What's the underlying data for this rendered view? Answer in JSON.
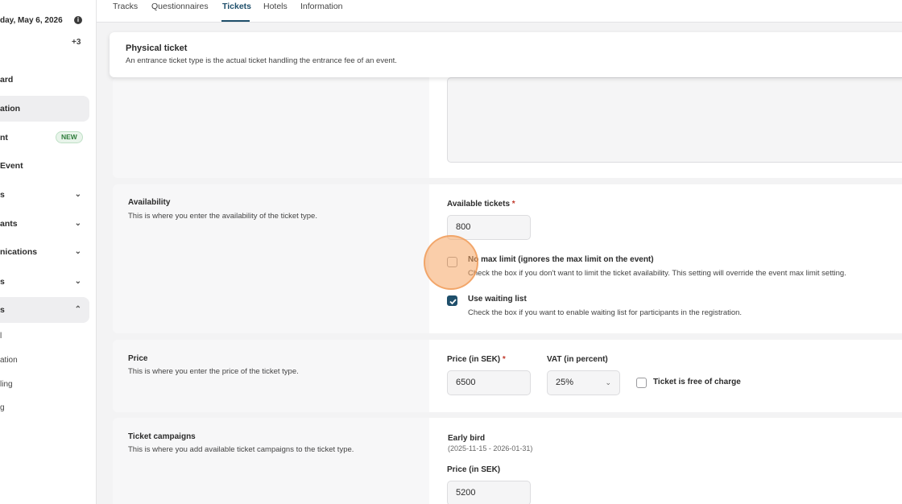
{
  "sidebar": {
    "date": "day, May 6, 2026",
    "more_count": "+3",
    "items": [
      {
        "label": "ard"
      },
      {
        "label": "ation"
      },
      {
        "label": "nt",
        "badge": "NEW"
      },
      {
        "label": "Event"
      },
      {
        "label": "s"
      },
      {
        "label": "ants"
      },
      {
        "label": "nications"
      },
      {
        "label": "s"
      },
      {
        "label": "s"
      }
    ],
    "sub_items": [
      "l",
      "ation",
      "ling",
      "g"
    ]
  },
  "tabs": [
    {
      "label": "Tracks"
    },
    {
      "label": "Questionnaires"
    },
    {
      "label": "Tickets",
      "active": true
    },
    {
      "label": "Hotels"
    },
    {
      "label": "Information"
    }
  ],
  "header": {
    "title": "Physical ticket",
    "description": "An entrance ticket type is the actual ticket handling the entrance fee of an event."
  },
  "availability": {
    "title": "Availability",
    "description": "This is where you enter the availability of the ticket type.",
    "tickets_label": "Available tickets",
    "tickets_value": "800",
    "no_max": {
      "title": "No max limit (ignores the max limit on the event)",
      "description": "Check the box if you don't want to limit the ticket availability. This setting will override the event max limit setting.",
      "checked": false
    },
    "waiting": {
      "title": "Use waiting list",
      "description": "Check the box if you want to enable waiting list for participants in the registration.",
      "checked": true
    }
  },
  "price": {
    "title": "Price",
    "description": "This is where you enter the price of the ticket type.",
    "price_label": "Price (in SEK)",
    "price_value": "6500",
    "vat_label": "VAT (in percent)",
    "vat_value": "25%",
    "free_label": "Ticket is free of charge",
    "free_checked": false
  },
  "campaigns": {
    "title": "Ticket campaigns",
    "description": "This is where you add available ticket campaigns to the ticket type.",
    "campaign_name": "Early bird",
    "campaign_dates": "(2025-11-15 - 2026-01-31)",
    "price_label": "Price (in SEK)",
    "price_value": "5200"
  },
  "required_marker": "*"
}
